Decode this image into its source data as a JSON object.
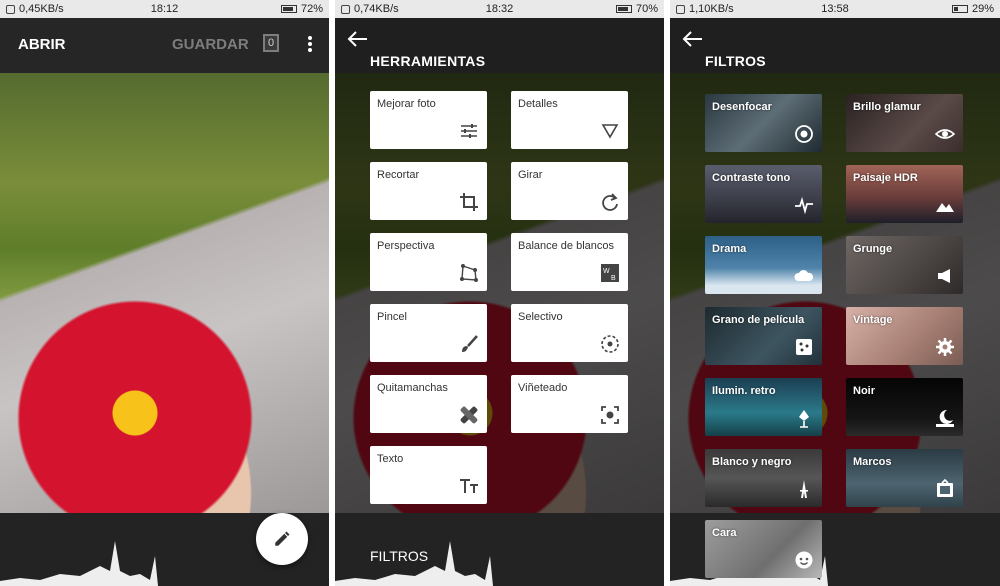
{
  "screens": [
    {
      "status": {
        "left": "0,45KB/s",
        "time": "18:12",
        "battery": "72%"
      },
      "toolbar": {
        "open_label": "ABRIR",
        "save_label": "GUARDAR",
        "count": "0"
      }
    },
    {
      "status": {
        "left": "0,74KB/s",
        "time": "18:32",
        "battery": "70%"
      },
      "title": "HERRAMIENTAS",
      "tools": [
        {
          "label": "Mejorar foto",
          "icon": "sliders-icon"
        },
        {
          "label": "Detalles",
          "icon": "triangle-icon"
        },
        {
          "label": "Recortar",
          "icon": "crop-icon"
        },
        {
          "label": "Girar",
          "icon": "rotate-icon"
        },
        {
          "label": "Perspectiva",
          "icon": "perspective-icon"
        },
        {
          "label": "Balance de blancos",
          "icon": "wb-icon"
        },
        {
          "label": "Pincel",
          "icon": "brush-icon"
        },
        {
          "label": "Selectivo",
          "icon": "selective-icon"
        },
        {
          "label": "Quitamanchas",
          "icon": "healing-icon"
        },
        {
          "label": "Viñeteado",
          "icon": "vignette-icon"
        },
        {
          "label": "Texto",
          "icon": "text-icon"
        }
      ],
      "bottom_label": "FILTROS"
    },
    {
      "status": {
        "left": "1,10KB/s",
        "time": "13:58",
        "battery": "29%"
      },
      "title": "FILTROS",
      "filters": [
        {
          "label": "Desenfocar",
          "icon": "target-icon",
          "color": "#3b4a55"
        },
        {
          "label": "Brillo glamur",
          "icon": "eye-icon",
          "color": "#3e3534"
        },
        {
          "label": "Contraste tono",
          "icon": "pulse-icon",
          "color": "#4a4c5a"
        },
        {
          "label": "Paisaje HDR",
          "icon": "mountain-icon",
          "color": "#7b4f48"
        },
        {
          "label": "Drama",
          "icon": "cloud-icon",
          "color": "#3f6a8d"
        },
        {
          "label": "Grunge",
          "icon": "megaphone-icon",
          "color": "#5a5553"
        },
        {
          "label": "Grano de película",
          "icon": "film-grain-icon",
          "color": "#2f4048"
        },
        {
          "label": "Vintage",
          "icon": "gear-icon",
          "color": "#b08c80"
        },
        {
          "label": "Ilumin. retro",
          "icon": "retro-icon",
          "color": "#1f5e70"
        },
        {
          "label": "Noir",
          "icon": "moon-icon",
          "color": "#121212"
        },
        {
          "label": "Blanco y negro",
          "icon": "eiffel-icon",
          "color": "#454545"
        },
        {
          "label": "Marcos",
          "icon": "frame-icon",
          "color": "#3d5058"
        },
        {
          "label": "Cara",
          "icon": "face-icon",
          "color": "#8a8a8a"
        }
      ]
    }
  ]
}
